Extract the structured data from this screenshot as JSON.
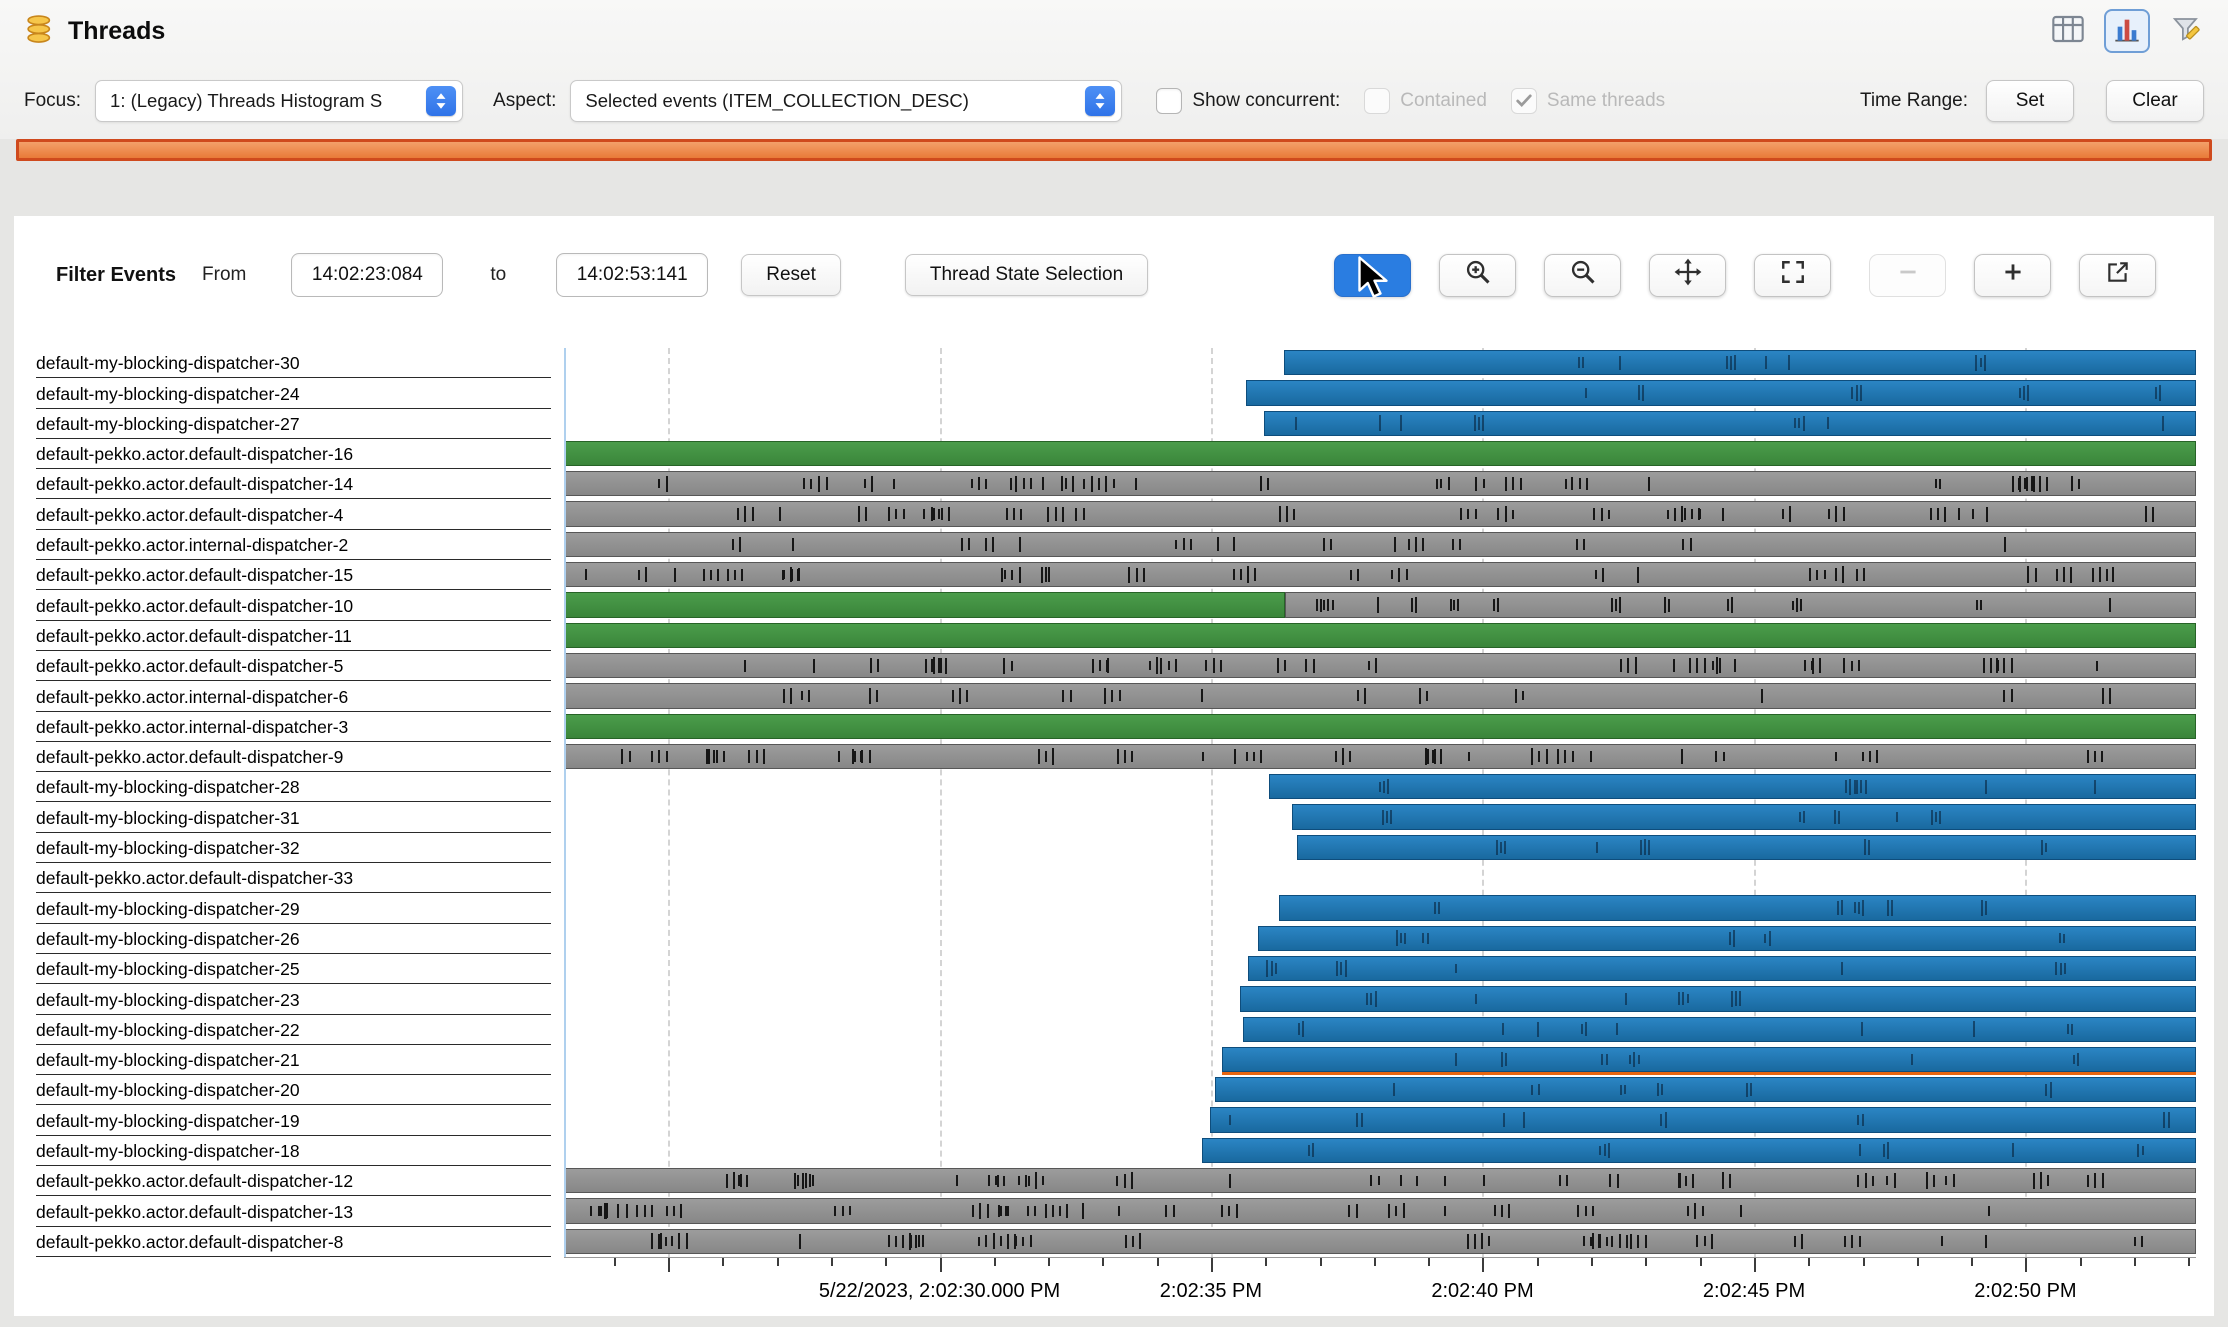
{
  "window": {
    "title": "Threads"
  },
  "toolbar": {
    "focus": {
      "label": "Focus:",
      "value": "1: (Legacy) Threads Histogram S"
    },
    "aspect": {
      "label": "Aspect:",
      "value": "Selected events (ITEM_COLLECTION_DESC)"
    },
    "show_concurrent": {
      "label": "Show concurrent:",
      "checked": false,
      "disabled": false
    },
    "contained": {
      "label": "Contained",
      "checked": false,
      "disabled": true
    },
    "same_threads": {
      "label": "Same threads",
      "checked": true,
      "disabled": true
    },
    "time_range_label": "Time Range:",
    "set_button": "Set",
    "clear_button": "Clear"
  },
  "filter_bar": {
    "title": "Filter Events",
    "from_label": "From",
    "from_value": "14:02:23:084",
    "to_label": "to",
    "to_value": "14:02:53:141",
    "reset_button": "Reset",
    "thread_state_button": "Thread State Selection",
    "tools": [
      {
        "name": "select-cursor",
        "active": true
      },
      {
        "name": "zoom-in"
      },
      {
        "name": "zoom-out"
      },
      {
        "name": "pan"
      },
      {
        "name": "fit-to-window"
      },
      {
        "name": "minus",
        "disabled": true
      },
      {
        "name": "plus"
      },
      {
        "name": "open-in-new"
      }
    ]
  },
  "colors": {
    "accent_blue": "#2a7de1",
    "bar_blue": "#1f77b4",
    "bar_green": "#3c8f3f",
    "bar_grey": "#8c8c8c",
    "range_strip_fill": "#e97a38",
    "range_strip_border": "#cf4a1d",
    "selection_line": "#afd0ee",
    "highlight_orange": "#e8650f"
  },
  "chart_data": {
    "type": "timeline",
    "x_start_s": 23.084,
    "x_end_s": 53.141,
    "x_start_label": "14:02:23:084",
    "x_end_label": "14:02:53:141",
    "minor_tick_seconds": 1,
    "major_tick_seconds": 5,
    "axis_labels": [
      {
        "text": "5/22/2023, 2:02:30.000 PM",
        "pct": 23.01
      },
      {
        "text": "2:02:35 PM",
        "pct": 39.64
      },
      {
        "text": "2:02:40 PM",
        "pct": 56.28
      },
      {
        "text": "2:02:45 PM",
        "pct": 72.92
      },
      {
        "text": "2:02:50 PM",
        "pct": 89.55
      }
    ],
    "threads": [
      {
        "name": "default-my-blocking-dispatcher-30",
        "segments": [
          {
            "state": "blue",
            "start_pct": 44.1,
            "end_pct": 100,
            "ticks": "sparse"
          }
        ]
      },
      {
        "name": "default-my-blocking-dispatcher-24",
        "segments": [
          {
            "state": "blue",
            "start_pct": 41.8,
            "end_pct": 100,
            "ticks": "sparse"
          }
        ]
      },
      {
        "name": "default-my-blocking-dispatcher-27",
        "segments": [
          {
            "state": "blue",
            "start_pct": 42.9,
            "end_pct": 100,
            "ticks": "sparse"
          }
        ]
      },
      {
        "name": "default-pekko.actor.default-dispatcher-16",
        "segments": [
          {
            "state": "green",
            "start_pct": 0,
            "end_pct": 100
          }
        ]
      },
      {
        "name": "default-pekko.actor.default-dispatcher-14",
        "segments": [
          {
            "state": "grey",
            "start_pct": 0,
            "end_pct": 100,
            "ticks": "dense"
          }
        ]
      },
      {
        "name": "default-pekko.actor.default-dispatcher-4",
        "segments": [
          {
            "state": "grey",
            "start_pct": 0,
            "end_pct": 100,
            "ticks": "dense"
          }
        ]
      },
      {
        "name": "default-pekko.actor.internal-dispatcher-2",
        "segments": [
          {
            "state": "grey",
            "start_pct": 0,
            "end_pct": 100,
            "ticks": "medium"
          }
        ]
      },
      {
        "name": "default-pekko.actor.default-dispatcher-15",
        "segments": [
          {
            "state": "grey",
            "start_pct": 0,
            "end_pct": 100,
            "ticks": "dense"
          }
        ]
      },
      {
        "name": "default-pekko.actor.default-dispatcher-10",
        "segments": [
          {
            "state": "green",
            "start_pct": 0,
            "end_pct": 44.2
          },
          {
            "state": "grey",
            "start_pct": 44.2,
            "end_pct": 100,
            "ticks": "medium"
          }
        ]
      },
      {
        "name": "default-pekko.actor.default-dispatcher-11",
        "segments": [
          {
            "state": "green",
            "start_pct": 0,
            "end_pct": 100
          }
        ]
      },
      {
        "name": "default-pekko.actor.default-dispatcher-5",
        "segments": [
          {
            "state": "grey",
            "start_pct": 0,
            "end_pct": 100,
            "ticks": "dense"
          }
        ]
      },
      {
        "name": "default-pekko.actor.internal-dispatcher-6",
        "segments": [
          {
            "state": "grey",
            "start_pct": 0,
            "end_pct": 100,
            "ticks": "medium"
          }
        ]
      },
      {
        "name": "default-pekko.actor.internal-dispatcher-3",
        "segments": [
          {
            "state": "green",
            "start_pct": 0,
            "end_pct": 100
          }
        ]
      },
      {
        "name": "default-pekko.actor.default-dispatcher-9",
        "segments": [
          {
            "state": "grey",
            "start_pct": 0,
            "end_pct": 100,
            "ticks": "dense"
          }
        ]
      },
      {
        "name": "default-my-blocking-dispatcher-28",
        "segments": [
          {
            "state": "blue",
            "start_pct": 43.2,
            "end_pct": 100,
            "ticks": "sparse"
          }
        ]
      },
      {
        "name": "default-my-blocking-dispatcher-31",
        "segments": [
          {
            "state": "blue",
            "start_pct": 44.6,
            "end_pct": 100,
            "ticks": "sparse"
          }
        ]
      },
      {
        "name": "default-my-blocking-dispatcher-32",
        "segments": [
          {
            "state": "blue",
            "start_pct": 44.9,
            "end_pct": 100,
            "ticks": "sparse"
          }
        ]
      },
      {
        "name": "default-pekko.actor.default-dispatcher-33",
        "segments": []
      },
      {
        "name": "default-my-blocking-dispatcher-29",
        "segments": [
          {
            "state": "blue",
            "start_pct": 43.8,
            "end_pct": 100,
            "ticks": "sparse"
          }
        ]
      },
      {
        "name": "default-my-blocking-dispatcher-26",
        "segments": [
          {
            "state": "blue",
            "start_pct": 42.5,
            "end_pct": 100,
            "ticks": "sparse"
          }
        ]
      },
      {
        "name": "default-my-blocking-dispatcher-25",
        "segments": [
          {
            "state": "blue",
            "start_pct": 41.9,
            "end_pct": 100,
            "ticks": "sparse"
          }
        ]
      },
      {
        "name": "default-my-blocking-dispatcher-23",
        "segments": [
          {
            "state": "blue",
            "start_pct": 41.4,
            "end_pct": 100,
            "ticks": "sparse"
          }
        ]
      },
      {
        "name": "default-my-blocking-dispatcher-22",
        "segments": [
          {
            "state": "blue",
            "start_pct": 41.6,
            "end_pct": 100,
            "ticks": "sparse"
          }
        ]
      },
      {
        "name": "default-my-blocking-dispatcher-21",
        "segments": [
          {
            "state": "blue",
            "start_pct": 40.3,
            "end_pct": 100,
            "ticks": "sparse",
            "underline": true
          }
        ]
      },
      {
        "name": "default-my-blocking-dispatcher-20",
        "segments": [
          {
            "state": "blue",
            "start_pct": 39.9,
            "end_pct": 100,
            "ticks": "sparse"
          }
        ]
      },
      {
        "name": "default-my-blocking-dispatcher-19",
        "segments": [
          {
            "state": "blue",
            "start_pct": 39.6,
            "end_pct": 100,
            "ticks": "sparse"
          }
        ]
      },
      {
        "name": "default-my-blocking-dispatcher-18",
        "segments": [
          {
            "state": "blue",
            "start_pct": 39.1,
            "end_pct": 100,
            "ticks": "sparse"
          }
        ]
      },
      {
        "name": "default-pekko.actor.default-dispatcher-12",
        "segments": [
          {
            "state": "grey",
            "start_pct": 0,
            "end_pct": 100,
            "ticks": "dense"
          }
        ]
      },
      {
        "name": "default-pekko.actor.default-dispatcher-13",
        "segments": [
          {
            "state": "grey",
            "start_pct": 0,
            "end_pct": 100,
            "ticks": "dense",
            "skew": "left"
          }
        ]
      },
      {
        "name": "default-pekko.actor.default-dispatcher-8",
        "segments": [
          {
            "state": "grey",
            "start_pct": 0,
            "end_pct": 100,
            "ticks": "dense"
          }
        ]
      }
    ]
  }
}
